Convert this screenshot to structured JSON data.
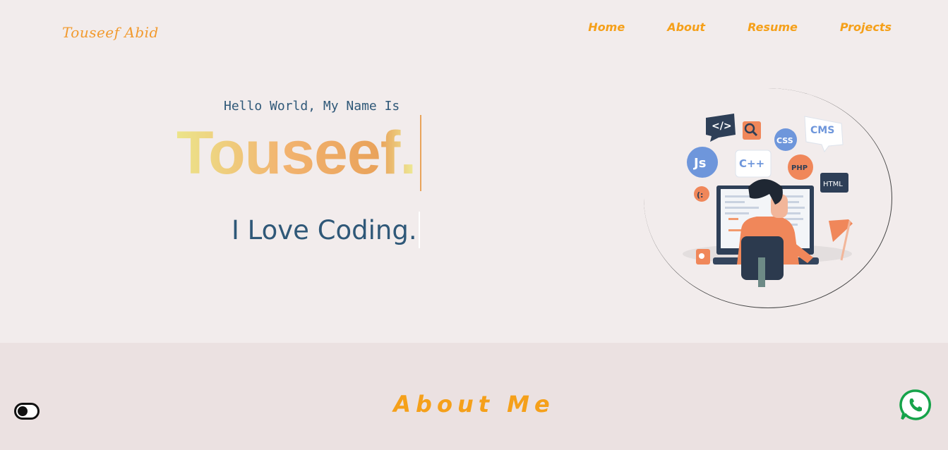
{
  "header": {
    "logo": "Touseef Abid",
    "nav": [
      "Home",
      "About",
      "Resume",
      "Projects"
    ]
  },
  "hero": {
    "greeting": "Hello World, My Name Is",
    "name": "Touseef.",
    "tagline": "I Love Coding."
  },
  "illustration": {
    "bubbles": [
      "</>",
      "Js",
      "C++",
      "CSS",
      "PHP",
      "CMS",
      "HTML",
      "(:"
    ]
  },
  "about": {
    "title": "About Me"
  },
  "icons": {
    "theme_toggle": "toggle-icon",
    "whatsapp": "whatsapp-icon"
  },
  "colors": {
    "accent": "#f5a01a",
    "text_blue": "#2f5878",
    "background": "#f2ecec",
    "about_background": "#ebe1e1",
    "whatsapp_green": "#16a34a"
  }
}
